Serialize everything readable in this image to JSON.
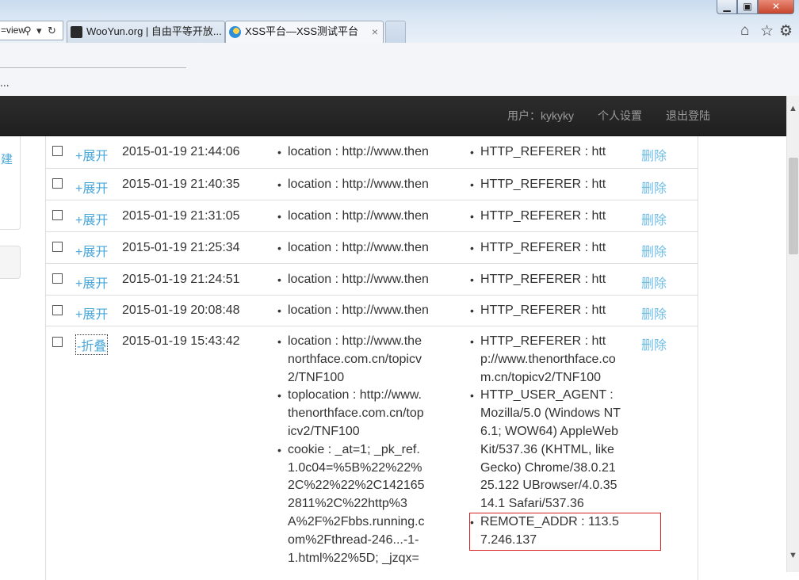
{
  "browser": {
    "address_text": "=view",
    "tabs": [
      {
        "label": "WooYun.org | 自由平等开放..."
      },
      {
        "label": "XSS平台—XSS测试平台"
      }
    ],
    "window_buttons": {
      "minimize": "▁",
      "maximize": "▣",
      "close": "✕"
    },
    "ellipsis": "..."
  },
  "navbar": {
    "user": "用户：kykyky",
    "settings": "个人设置",
    "logout": "退出登陆"
  },
  "sidebar": {
    "partial_label": "建"
  },
  "table": {
    "delete_label": "删除",
    "expand_label": "+展开",
    "collapse_label": "-折叠",
    "rows": [
      {
        "time": "2015-01-19 21:44:06",
        "col1": [
          "location : http://www.then"
        ],
        "col2": [
          "HTTP_REFERER : htt"
        ]
      },
      {
        "time": "2015-01-19 21:40:35",
        "col1": [
          "location : http://www.then"
        ],
        "col2": [
          "HTTP_REFERER : htt"
        ]
      },
      {
        "time": "2015-01-19 21:31:05",
        "col1": [
          "location : http://www.then"
        ],
        "col2": [
          "HTTP_REFERER : htt"
        ]
      },
      {
        "time": "2015-01-19 21:25:34",
        "col1": [
          "location : http://www.then"
        ],
        "col2": [
          "HTTP_REFERER : htt"
        ]
      },
      {
        "time": "2015-01-19 21:24:51",
        "col1": [
          "location : http://www.then"
        ],
        "col2": [
          "HTTP_REFERER : htt"
        ]
      },
      {
        "time": "2015-01-19 20:08:48",
        "col1": [
          "location : http://www.then"
        ],
        "col2": [
          "HTTP_REFERER : htt"
        ]
      }
    ],
    "expanded_row": {
      "time": "2015-01-19 15:43:42",
      "col1": [
        "location : http://www.thenorthface.com.cn/topicv2/TNF100",
        "toplocation : http://www.thenorthface.com.cn/topicv2/TNF100",
        "cookie : _at=1; _pk_ref.1.0c04=%5B%22%22%2C%22%22%2C1421652811%2C%22http%3A%2F%2Fbbs.running.com%2Fthread-246...-1-1.html%22%5D; _jzqx="
      ],
      "col2": [
        "HTTP_REFERER : http://www.thenorthface.com.cn/topicv2/TNF100",
        "HTTP_USER_AGENT : Mozilla/5.0 (Windows NT 6.1; WOW64) AppleWebKit/537.36 (KHTML, like Gecko) Chrome/38.0.2125.122 UBrowser/4.0.3514.1 Safari/537.36",
        "REMOTE_ADDR : 113.57.246.137"
      ]
    }
  }
}
